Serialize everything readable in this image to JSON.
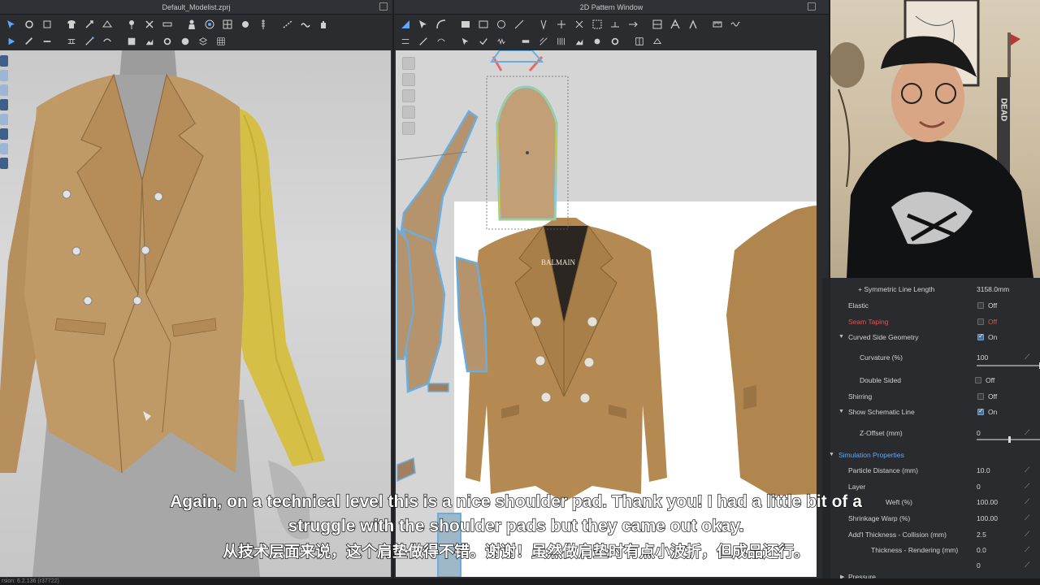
{
  "window_3d": {
    "title": "Default_Modelist.zprj"
  },
  "window_2d": {
    "title": "2D Pattern Window"
  },
  "photo_brand": "BALMAIN",
  "webcam_shirt_text": "DEAD",
  "property_editor": {
    "rows": [
      {
        "label": "+ Symmetric Line Length",
        "value": "3158.0mm"
      },
      {
        "label": "Elastic",
        "value": "Off"
      },
      {
        "label": "Seam Taping",
        "value": "Off"
      },
      {
        "label": "Curved Side Geometry",
        "value": "On"
      },
      {
        "label": "Curvature (%)",
        "value": "100"
      },
      {
        "label": "Double Sided",
        "value": "Off"
      },
      {
        "label": "Shirring",
        "value": "Off"
      },
      {
        "label": "Show Schematic Line",
        "value": "On"
      },
      {
        "label": "Z-Offset (mm)",
        "value": "0"
      },
      {
        "label": "Simulation Properties",
        "value": ""
      },
      {
        "label": "Particle Distance (mm)",
        "value": "10.0"
      },
      {
        "label": "Layer",
        "value": "0"
      },
      {
        "label": "Weft (%)",
        "value": "100.00"
      },
      {
        "label": "Shrinkage Warp (%)",
        "value": "100.00"
      },
      {
        "label": "Add'l Thickness - Collision (mm)",
        "value": "2.5"
      },
      {
        "label": "Thickness - Rendering (mm)",
        "value": "0.0"
      },
      {
        "label": "",
        "value": "0"
      },
      {
        "label": "Pressure",
        "value": ""
      }
    ],
    "curvature_level": 1.0,
    "z_offset_level": 0.5
  },
  "subtitles": {
    "line1": "Again, on a technical level this is a nice shoulder pad. Thank you! I had a little bit of a",
    "line2": "struggle with the shoulder pads but they came out okay.",
    "line3": "从技术层面来说，这个肩垫做得不错。谢谢！虽然做肩垫时有点小波折，但成品还行。"
  },
  "status_bar": {
    "version": "rsion: 6.2.136 (r37722)"
  },
  "colors": {
    "jacket": "#c09a66",
    "sleeve_highlight": "#d9c24a",
    "pattern_outline": "#6aaee0",
    "accent_blue": "#6aa6ef",
    "warning_red": "#e2524d"
  }
}
